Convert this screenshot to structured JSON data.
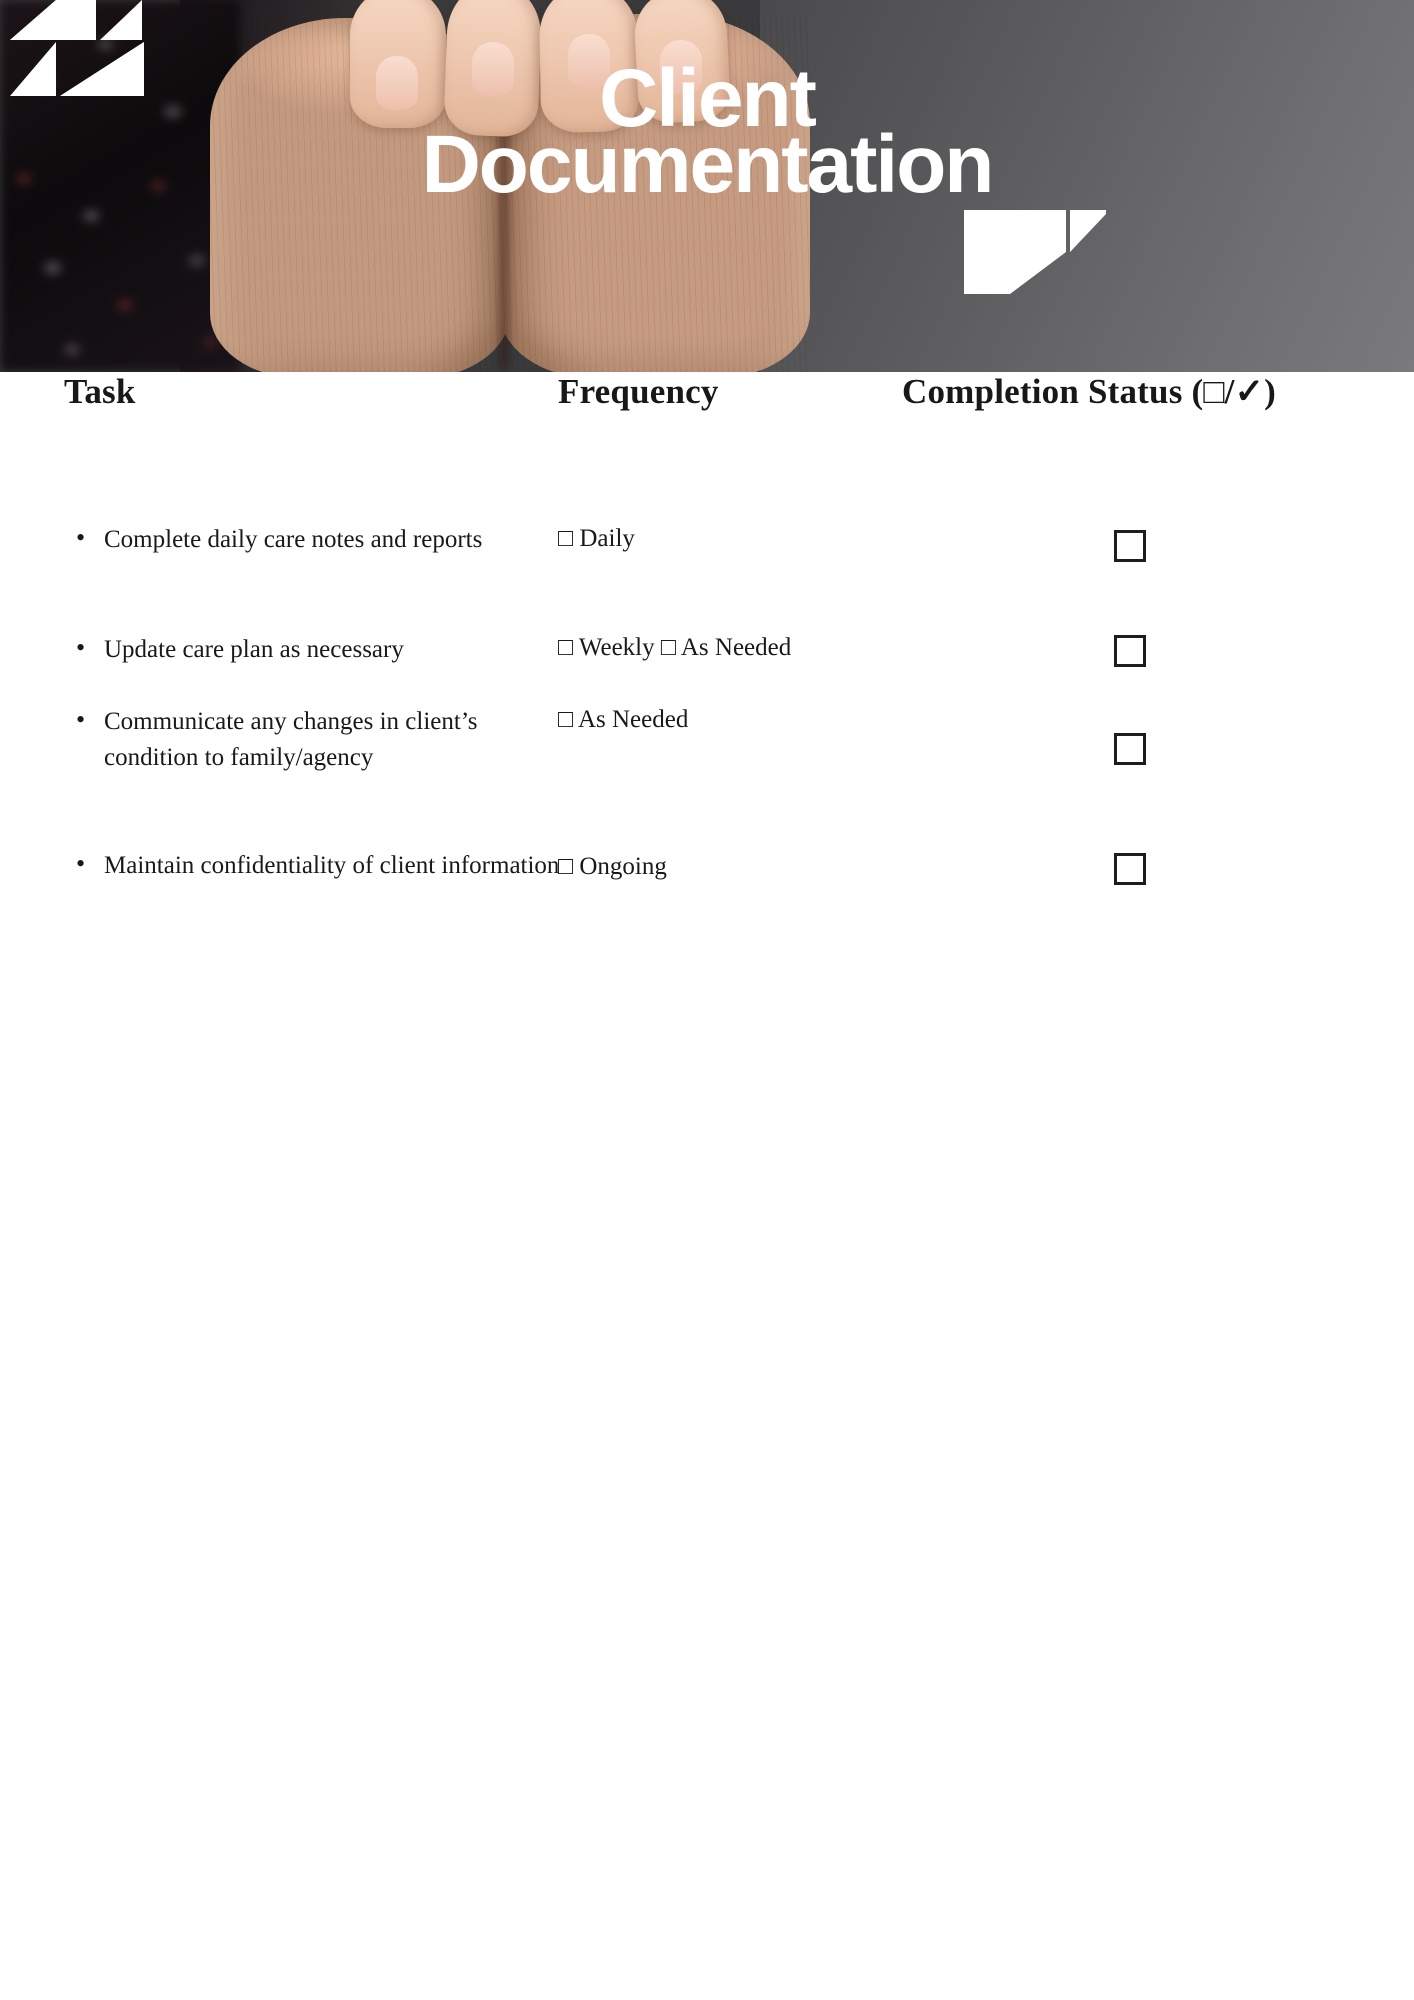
{
  "banner": {
    "title_line1": "Client",
    "title_line2": "Documentation",
    "logo_top_left": "brand-chevron-mark",
    "logo_bottom_right": "brand-chevron-mark",
    "photo": "elderly-hands-held-photo"
  },
  "table": {
    "headers": {
      "task": "Task",
      "frequency": "Frequency",
      "status": "Completion Status (□/✓)"
    },
    "rows": [
      {
        "task": "Complete daily care notes and reports",
        "frequency": "□ Daily",
        "checked": false
      },
      {
        "task": "Update care plan as necessary",
        "frequency": "□ Weekly □ As Needed",
        "checked": false
      },
      {
        "task": "Communicate any changes in client’s condition to family/agency",
        "frequency": "□ As Needed",
        "checked": false
      },
      {
        "task": "Maintain confidentiality of client information",
        "frequency": "□ Ongoing",
        "checked": false
      }
    ]
  },
  "colors": {
    "text": "#17191b",
    "banner_backdrop": "#6f6f71",
    "logo": "#ffffff",
    "page_background": "#ffffff"
  }
}
